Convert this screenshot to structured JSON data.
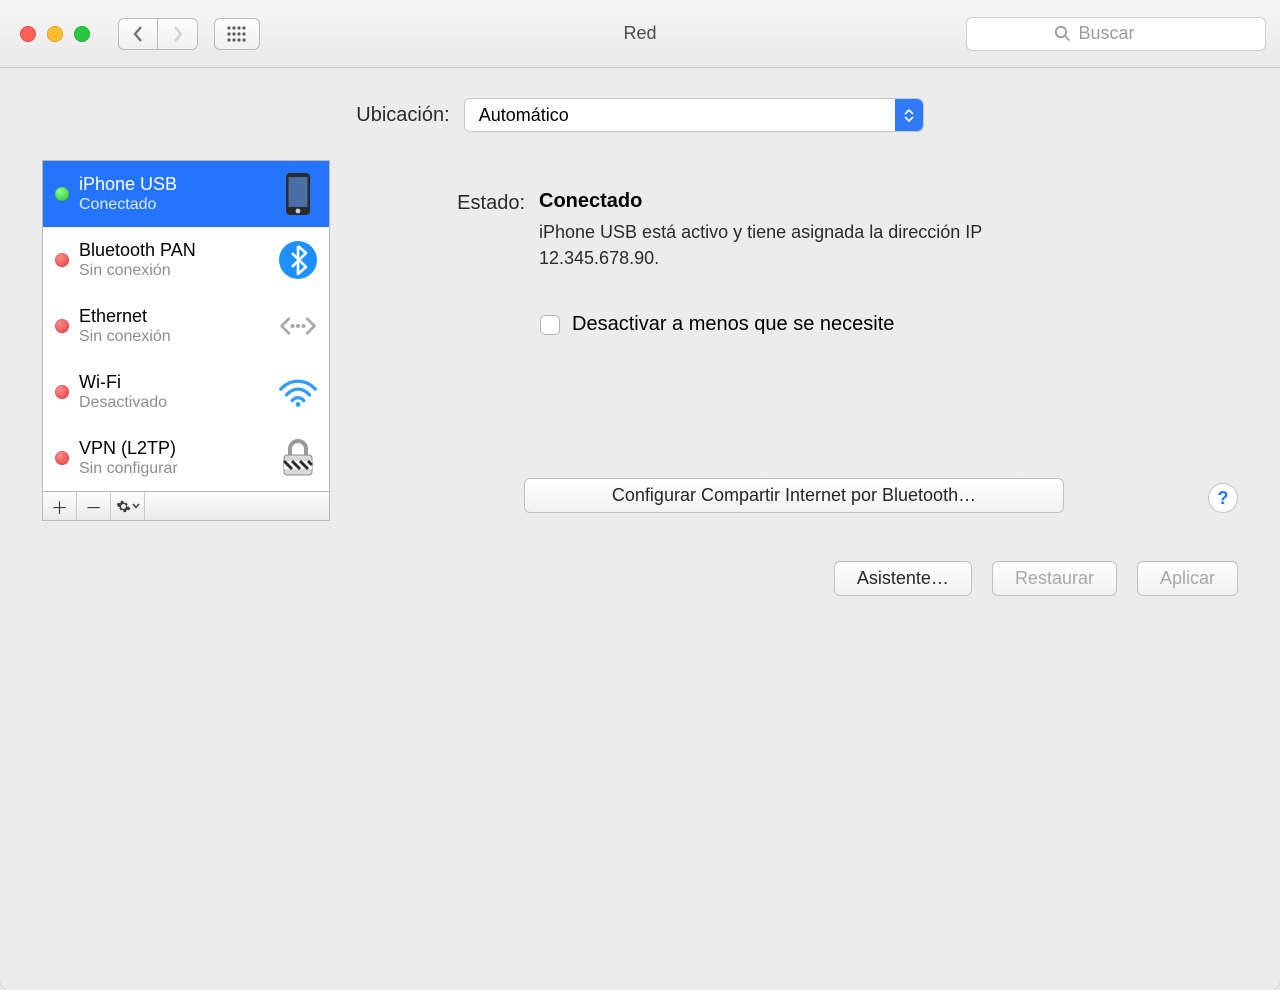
{
  "window": {
    "title": "Red"
  },
  "search": {
    "placeholder": "Buscar"
  },
  "location": {
    "label": "Ubicación:",
    "value": "Automático"
  },
  "services": [
    {
      "name": "iPhone USB",
      "status": "Conectado",
      "dot": "green",
      "icon": "iphone",
      "selected": true
    },
    {
      "name": "Bluetooth PAN",
      "status": "Sin conexión",
      "dot": "red",
      "icon": "bluetooth",
      "selected": false
    },
    {
      "name": "Ethernet",
      "status": "Sin conexión",
      "dot": "red",
      "icon": "ethernet",
      "selected": false
    },
    {
      "name": "Wi-Fi",
      "status": "Desactivado",
      "dot": "red",
      "icon": "wifi",
      "selected": false
    },
    {
      "name": "VPN (L2TP)",
      "status": "Sin configurar",
      "dot": "red",
      "icon": "vpn",
      "selected": false
    }
  ],
  "detail": {
    "status_label": "Estado:",
    "status_value": "Conectado",
    "status_description": "iPhone USB está activo y tiene asignada la dirección IP 12.345.678.90.",
    "disable_checkbox_label": "Desactivar a menos que se necesite",
    "configure_button": "Configurar Compartir Internet por Bluetooth…"
  },
  "buttons": {
    "assistant": "Asistente…",
    "revert": "Restaurar",
    "apply": "Aplicar"
  }
}
